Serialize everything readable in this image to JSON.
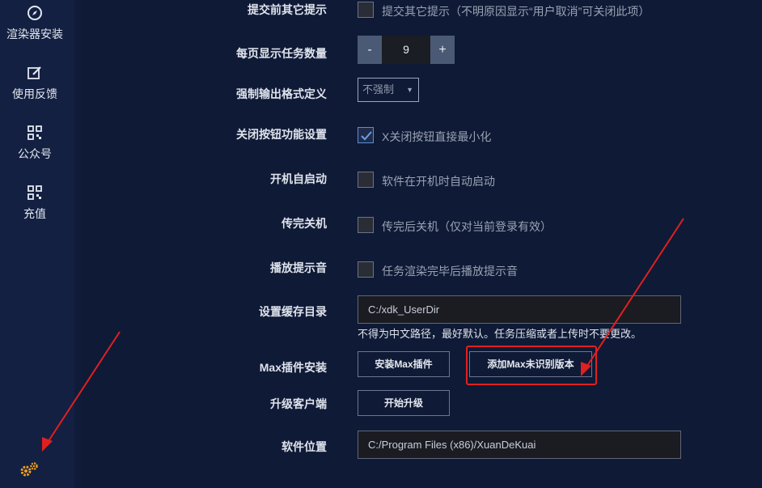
{
  "sidebar": {
    "items": [
      {
        "label": "渲染器安装",
        "icon": "compass-icon"
      },
      {
        "label": "使用反馈",
        "icon": "edit-icon"
      },
      {
        "label": "公众号",
        "icon": "qrcode-icon"
      },
      {
        "label": "充值",
        "icon": "qrcode-icon"
      }
    ],
    "settings_icon": "gear-icon"
  },
  "settings": {
    "submit_tip": {
      "label": "提交前其它提示",
      "option": "提交其它提示（不明原因显示“用户取消”可关闭此项）",
      "checked": false
    },
    "per_page": {
      "label": "每页显示任务数量",
      "minus": "-",
      "value": "9",
      "plus": "+"
    },
    "force_format": {
      "label": "强制输出格式定义",
      "selected": "不强制"
    },
    "close_button": {
      "label": "关闭按钮功能设置",
      "option": "X关闭按钮直接最小化",
      "checked": true
    },
    "autostart": {
      "label": "开机自启动",
      "option": "软件在开机时自动启动",
      "checked": false
    },
    "shutdown": {
      "label": "传完关机",
      "option": "传完后关机（仅对当前登录有效）",
      "checked": false
    },
    "sound": {
      "label": "播放提示音",
      "option": "任务渲染完毕后播放提示音",
      "checked": false
    },
    "cache_dir": {
      "label": "设置缓存目录",
      "value": "C:/xdk_UserDir",
      "hint": "不得为中文路径，最好默认。任务压缩或者上传时不要更改。"
    },
    "max_plugin": {
      "label": "Max插件安装",
      "install_button": "安装Max插件",
      "add_version_button": "添加Max未识别版本"
    },
    "upgrade": {
      "label": "升级客户端",
      "button": "开始升级"
    },
    "location": {
      "label": "软件位置",
      "value": "C:/Program Files (x86)/XuanDeKuai"
    }
  },
  "colors": {
    "background": "#0f1a36",
    "sidebar": "#132042",
    "annotation": "#e02020",
    "gear": "#f0a020"
  }
}
